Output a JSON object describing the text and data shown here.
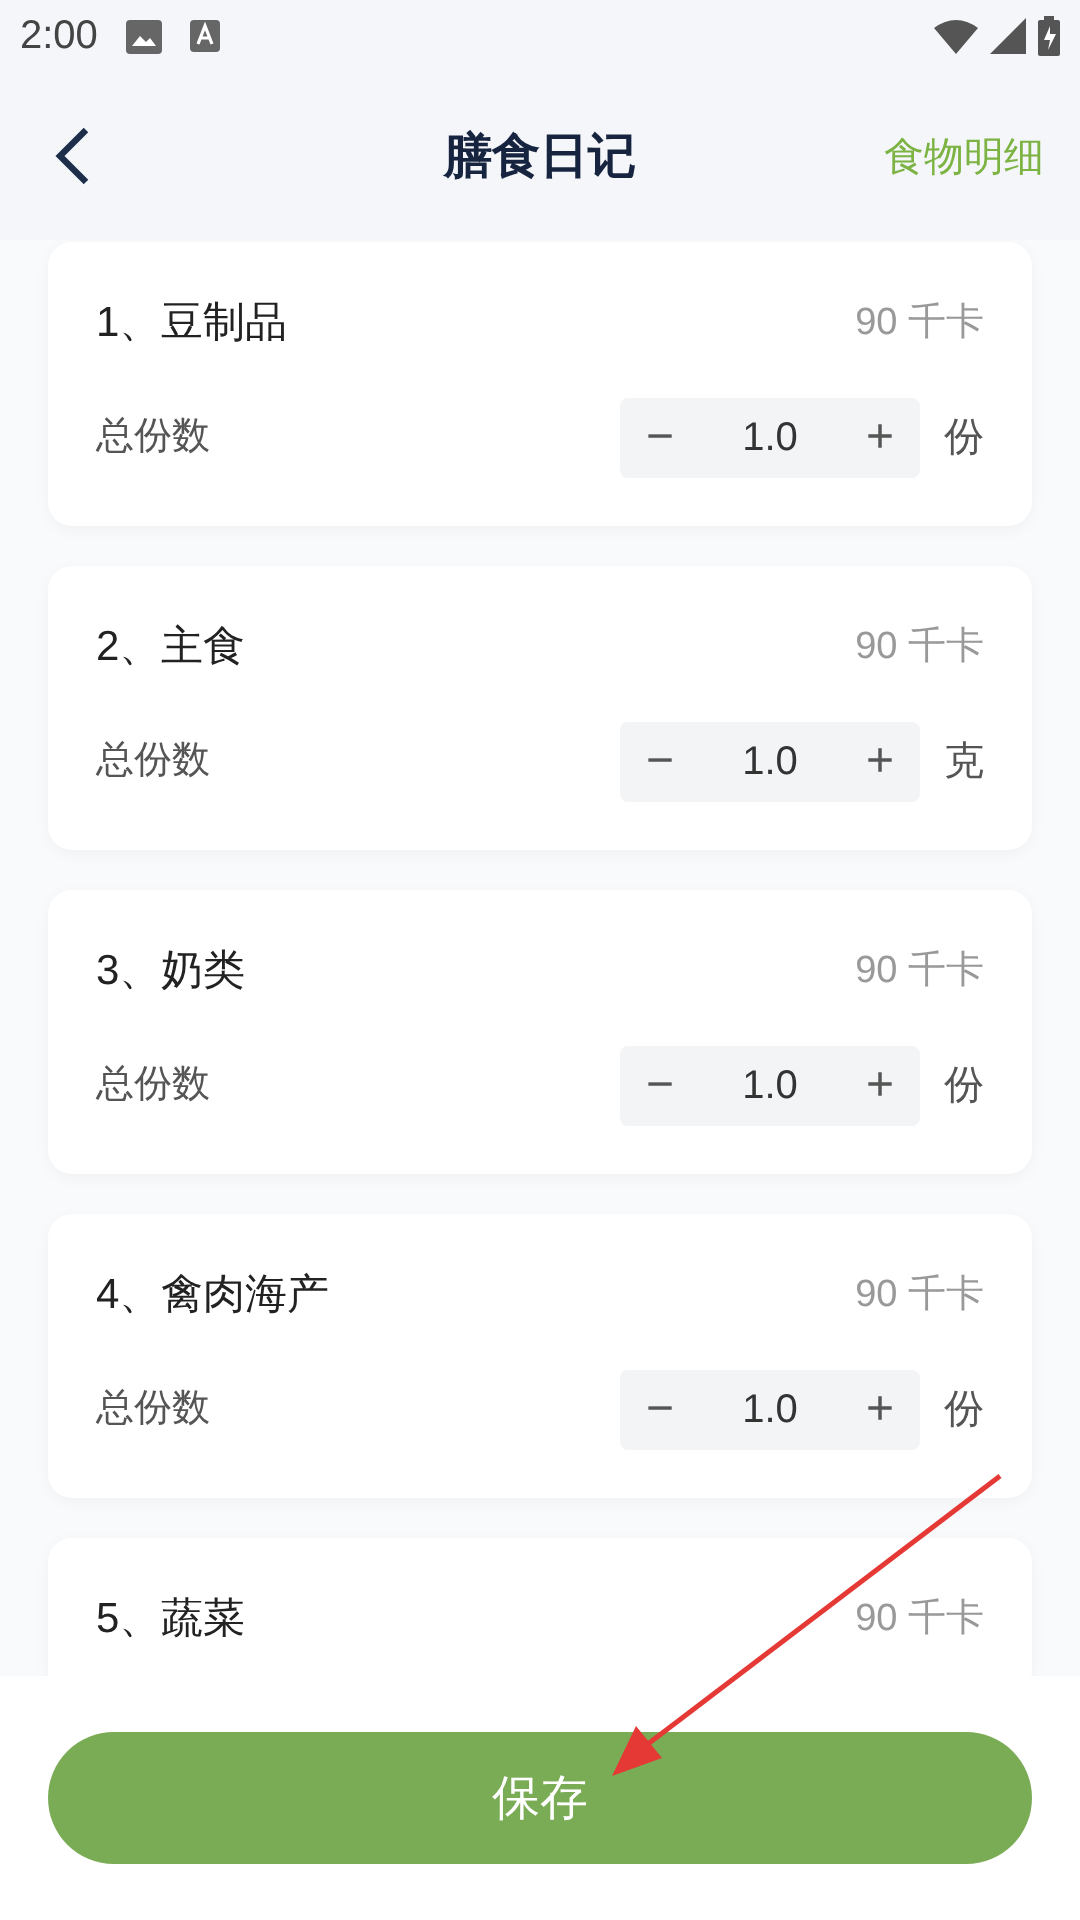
{
  "status_bar": {
    "time": "2:00"
  },
  "header": {
    "title": "膳食日记",
    "action": "食物明细"
  },
  "items": [
    {
      "title": "1、豆制品",
      "calories": "90 千卡",
      "quantity_label": "总份数",
      "minus": "−",
      "quantity": "1.0",
      "plus": "+",
      "unit": "份"
    },
    {
      "title": "2、主食",
      "calories": "90 千卡",
      "quantity_label": "总份数",
      "minus": "−",
      "quantity": "1.0",
      "plus": "+",
      "unit": "克"
    },
    {
      "title": "3、奶类",
      "calories": "90 千卡",
      "quantity_label": "总份数",
      "minus": "−",
      "quantity": "1.0",
      "plus": "+",
      "unit": "份"
    },
    {
      "title": "4、禽肉海产",
      "calories": "90 千卡",
      "quantity_label": "总份数",
      "minus": "−",
      "quantity": "1.0",
      "plus": "+",
      "unit": "份"
    },
    {
      "title": "5、蔬菜",
      "calories": "90 千卡"
    }
  ],
  "save_button": "保存"
}
